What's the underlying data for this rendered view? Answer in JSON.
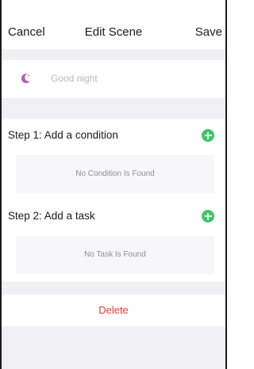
{
  "navbar": {
    "cancel_label": "Cancel",
    "title": "Edit Scene",
    "save_label": "Save"
  },
  "scene": {
    "icon": "moon-icon",
    "icon_color": "#b65fb6",
    "name_placeholder": "Good night"
  },
  "steps": [
    {
      "title": "Step 1: Add a condition",
      "empty_text": "No Condition Is Found",
      "add_icon": "plus-icon"
    },
    {
      "title": "Step 2: Add a task",
      "empty_text": "No Task Is Found",
      "add_icon": "plus-icon"
    }
  ],
  "actions": {
    "delete_label": "Delete",
    "delete_color": "#e53935"
  },
  "colors": {
    "accent_green": "#3cc766",
    "background": "#efeff4"
  }
}
